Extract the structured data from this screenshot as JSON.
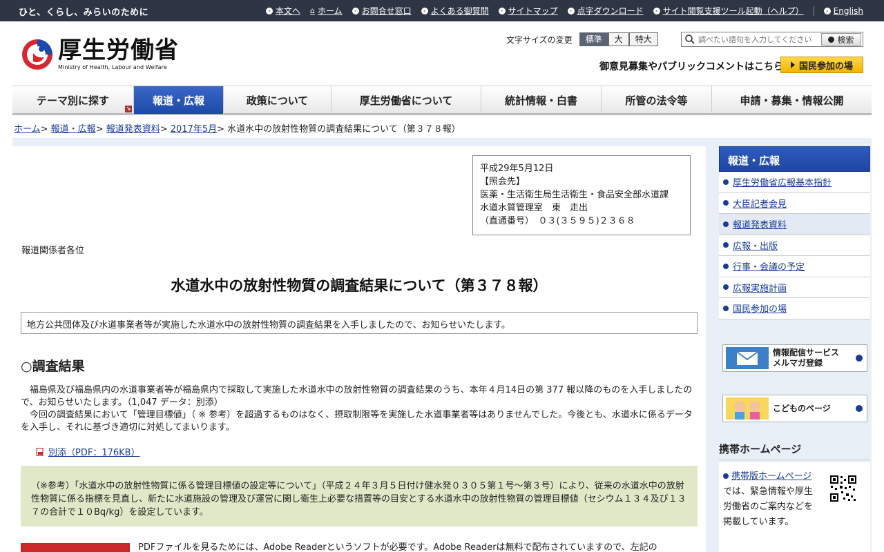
{
  "topbar": {
    "tagline": "ひと、くらし、みらいのために",
    "links": [
      "本文へ",
      "ホーム",
      "お問合せ窓口",
      "よくある御質問",
      "サイトマップ",
      "点字ダウンロード",
      "サイト閲覧支援ツール起動（ヘルプ）",
      "English"
    ]
  },
  "header": {
    "logo_jp": "厚生労働省",
    "logo_en": "Ministry of Health, Labour and Welfare",
    "fontsize_label": "文字サイズの変更",
    "fontsize_options": [
      "標準",
      "大",
      "特大"
    ],
    "search_placeholder": "調べたい語句を入力してください",
    "search_button": "検索",
    "pubcomment": "御意見募集やパブリックコメントはこちら",
    "kokumin_button": "国民参加の場"
  },
  "gnav": [
    "テーマ別に探す",
    "報道・広報",
    "政策について",
    "厚生労働省について",
    "統計情報・白書",
    "所管の法令等",
    "申請・募集・情報公開"
  ],
  "breadcrumb": {
    "links": [
      "ホーム",
      "報道・広報",
      "報道発表資料",
      "2017年5月"
    ],
    "current": "水道水中の放射性物質の調査結果について（第３７８報）"
  },
  "info": {
    "date": "平成29年5月12日",
    "contact_label": "【照会先】",
    "dept": "医薬・生活衛生局生活衛生・食品安全部水道課",
    "office": "水道水質管理室　東　走出",
    "phone": "（直通番号）　０３(３５９５)２３６８"
  },
  "main": {
    "recipient": "報道関係者各位",
    "title": "水道水中の放射性物質の調査結果について（第３７８報）",
    "lead": "地方公共団体及び水道事業者等が実施した水道水中の放射性物質の調査結果を入手しましたので、お知らせいたします。",
    "section_title": "○調査結果",
    "body1": "福島県及び福島県内の水道事業者等が福島県内で採取して実施した水道水中の放射性物質の調査結果のうち、本年４月14日の第 377 報以降のものを入手しましたので、お知らせいたします。（1,047 データ：別添）",
    "body2": "今回の調査結果において「管理目標値」（ ※ 参考）を超過するものはなく、摂取制限等を実施した水道事業者等はありませんでした。今後とも、水道水に係るデータを入手し、それに基づき適切に対処してまいります。",
    "pdf_link": "別添（PDF：176KB）",
    "note": "（※参考）「水道水中の放射性物質に係る管理目標値の設定等について」（平成２４年３月５日付け健水発０３０５第１号～第３号）により、従来の水道水中の放射性物質に係る指標を見直し、新たに水道施設の管理及び運営に関し衛生上必要な措置等の目安とする水道水中の放射性物質の管理目標値（セシウム１３４及び１３７の合計で１０Bq/kg）を設定しています。",
    "adobe": "PDFファイルを見るためには、Adobe Readerというソフトが必要です。Adobe Readerは無料で配布されていますので、左記の"
  },
  "sidebar": {
    "heading": "報道・広報",
    "items": [
      "厚生労働省広報基本指針",
      "大臣記者会見",
      "報道発表資料",
      "広報・出版",
      "行事・会議の予定",
      "広報実施計画",
      "国民参加の場"
    ],
    "mailmag": [
      "情報配信サービス",
      "メルマガ登録"
    ],
    "kids": "こどものページ",
    "mobile_heading": "携帯ホームページ",
    "mobile_link": "携帯版ホームページ",
    "mobile_text": "では、緊急情報や厚生労働省のご案内などを掲載しています。"
  }
}
